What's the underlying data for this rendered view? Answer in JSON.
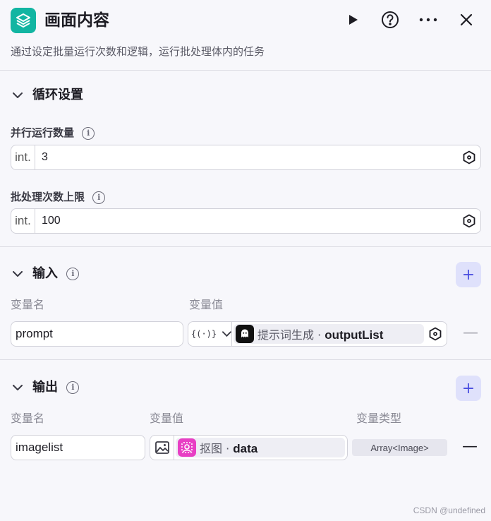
{
  "header": {
    "title": "画面内容",
    "description": "通过设定批量运行次数和逻辑，运行批处理体内的任务"
  },
  "loop_settings": {
    "title": "循环设置",
    "parallel_label": "并行运行数量",
    "parallel_type": "int.",
    "parallel_value": "3",
    "limit_label": "批处理次数上限",
    "limit_type": "int.",
    "limit_value": "100"
  },
  "input": {
    "title": "输入",
    "col_name": "变量名",
    "col_value": "变量值",
    "rows": [
      {
        "name": "prompt",
        "ref_type": "{(·)}",
        "node": "提示词生成",
        "separator": "·",
        "var": "outputList"
      }
    ]
  },
  "output": {
    "title": "输出",
    "col_name": "变量名",
    "col_value": "变量值",
    "col_type": "变量类型",
    "rows": [
      {
        "name": "imagelist",
        "node": "抠图",
        "separator": "·",
        "var": "data",
        "type": "Array<Image>"
      }
    ]
  },
  "footer": {
    "watermark": "CSDN @undefined"
  },
  "colors": {
    "accent": "#4b4fe0",
    "app_icon": "#12b5a2",
    "node_icon_prompt": "#111111",
    "node_icon_matting": "#e83fc4"
  },
  "icons": {
    "app": "layers-icon",
    "run": "play-icon",
    "help": "question-circle-icon",
    "more": "more-horizontal-icon",
    "close": "close-icon"
  }
}
